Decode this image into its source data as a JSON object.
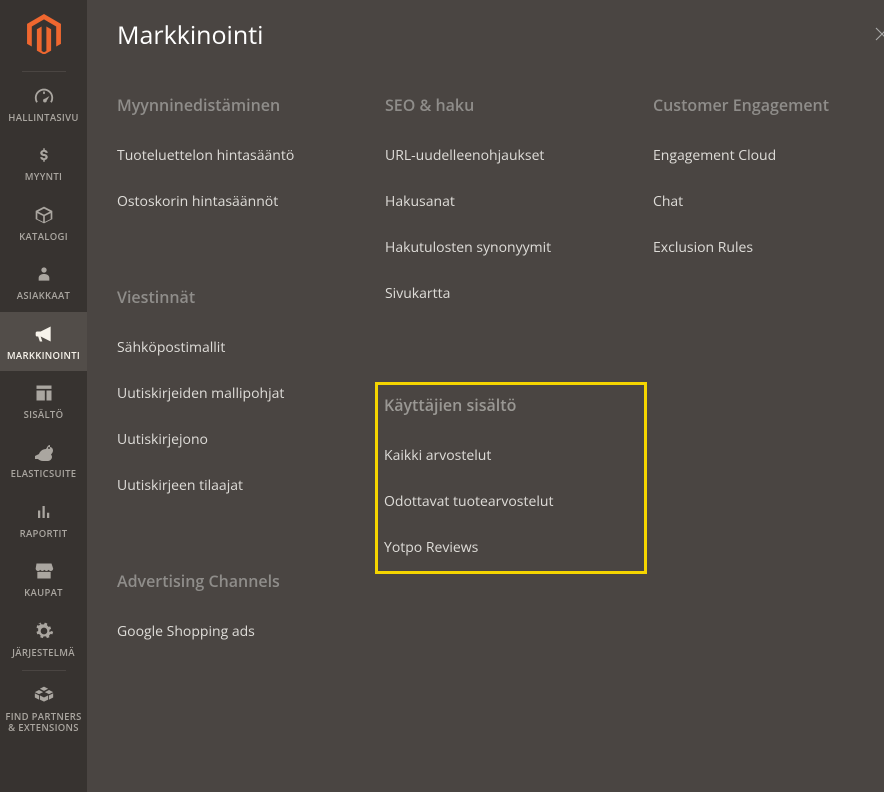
{
  "sidebar": {
    "items": [
      {
        "label": "HALLINTASIVU"
      },
      {
        "label": "MYYNTI"
      },
      {
        "label": "KATALOGI"
      },
      {
        "label": "ASIAKKAAT"
      },
      {
        "label": "MARKKINOINTI"
      },
      {
        "label": "SISÄLTÖ"
      },
      {
        "label": "ELASTICSUITE"
      },
      {
        "label": "RAPORTIT"
      },
      {
        "label": "KAUPAT"
      },
      {
        "label": "JÄRJESTELMÄ"
      },
      {
        "label": "FIND PARTNERS\n& EXTENSIONS"
      }
    ]
  },
  "panel": {
    "title": "Markkinointi",
    "columns": [
      {
        "sections": [
          {
            "title": "Myynninedistäminen",
            "items": [
              "Tuoteluettelon hintasääntö",
              "Ostoskorin hintasäännöt"
            ]
          },
          {
            "title": "Viestinnät",
            "items": [
              "Sähköpostimallit",
              "Uutiskirjeiden mallipohjat",
              "Uutiskirjejono",
              "Uutiskirjeen tilaajat"
            ]
          },
          {
            "title": "Advertising Channels",
            "items": [
              "Google Shopping ads"
            ]
          }
        ]
      },
      {
        "sections": [
          {
            "title": "SEO & haku",
            "items": [
              "URL-uudelleenohjaukset",
              "Hakusanat",
              "Hakutulosten synonyymit",
              "Sivukartta"
            ]
          }
        ],
        "highlight": {
          "title": "Käyttäjien sisältö",
          "items": [
            "Kaikki arvostelut",
            "Odottavat tuotearvostelut",
            "Yotpo Reviews"
          ]
        }
      },
      {
        "sections": [
          {
            "title": "Customer Engagement",
            "items": [
              "Engagement Cloud",
              "Chat",
              "Exclusion Rules"
            ]
          }
        ]
      }
    ]
  }
}
